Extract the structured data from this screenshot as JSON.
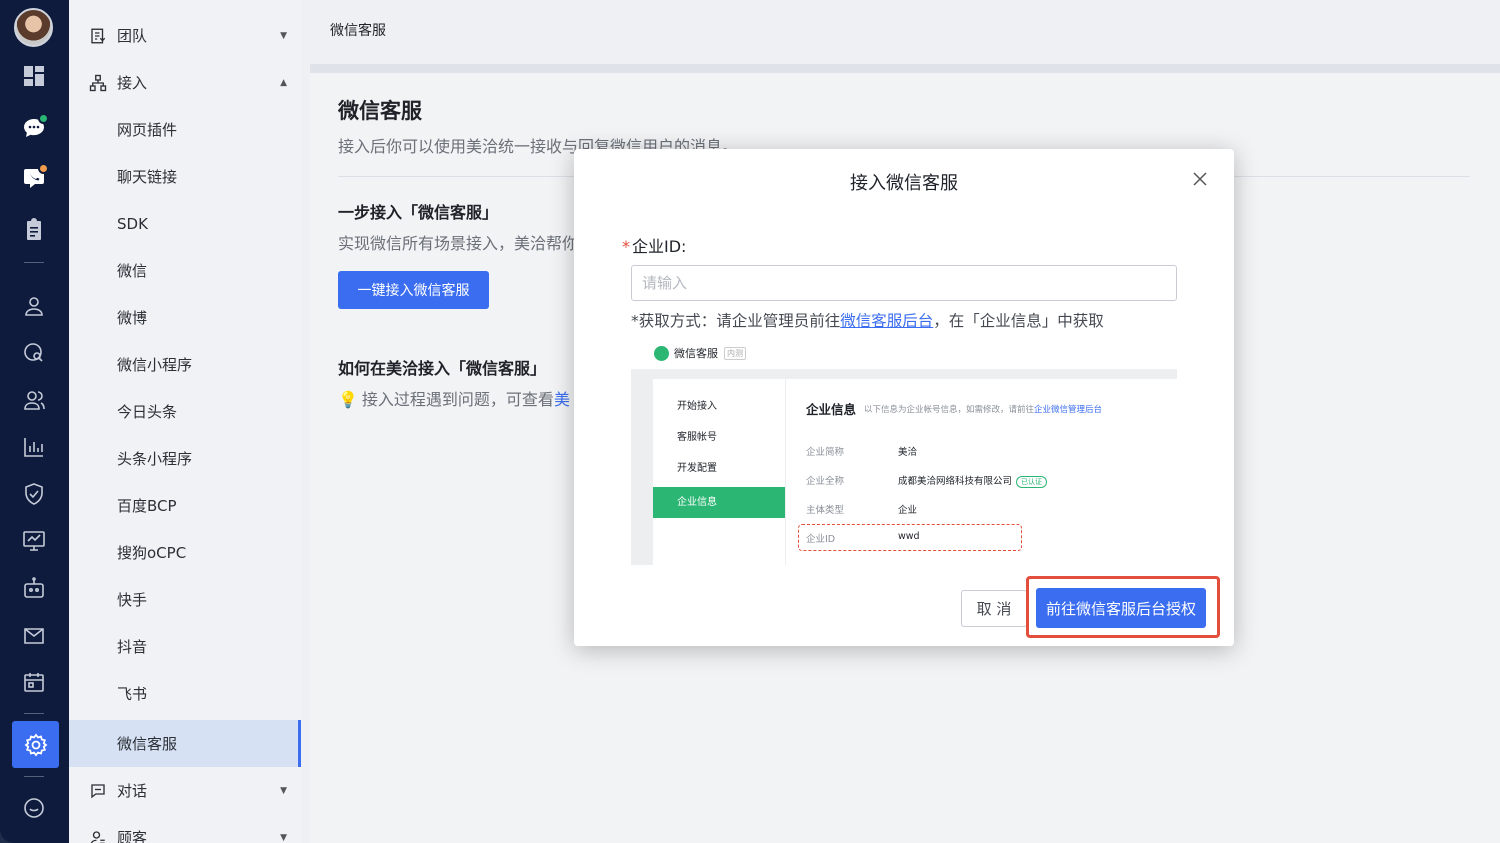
{
  "rail": {
    "icons": [
      "dashboard-icon",
      "chat-icon",
      "phone-chat-icon",
      "clipboard-icon",
      "user-icon",
      "search-user-icon",
      "users-icon",
      "bar-chart-icon",
      "shield-icon",
      "monitor-icon",
      "robot-icon",
      "mail-icon",
      "calendar-icon",
      "gear-icon",
      "message-icon"
    ]
  },
  "menu": {
    "team": "团队",
    "access": "接入",
    "sub_items": [
      "网页插件",
      "聊天链接",
      "SDK",
      "微信",
      "微博",
      "微信小程序",
      "今日头条",
      "头条小程序",
      "百度BCP",
      "搜狗oCPC",
      "快手",
      "抖音",
      "飞书",
      "微信客服"
    ],
    "dialog": "对话",
    "customer": "顾客"
  },
  "topbar": {
    "title": "微信客服"
  },
  "page": {
    "title": "微信客服",
    "description": "接入后你可以使用美洽统一接收与回复微信用户的消息。",
    "section1_title": "一步接入「微信客服」",
    "section1_desc": "实现微信所有场景接入，美洽帮你",
    "section1_button": "一键接入微信客服",
    "section2_title": "如何在美洽接入「微信客服」",
    "section2_desc": "接入过程遇到问题，可查看",
    "section2_link": "美"
  },
  "modal": {
    "title": "接入微信客服",
    "field_label": "企业ID:",
    "required_mark": "*",
    "field_value": "",
    "field_placeholder": "请输入",
    "hint_prefix": "*获取方式：请企业管理员前往",
    "hint_link": "微信客服后台",
    "hint_suffix": "，在「企业信息」中获取",
    "illustration": {
      "app_name": "微信客服",
      "app_tag": "内测",
      "side_items": [
        "开始接入",
        "客服帐号",
        "开发配置",
        "企业信息"
      ],
      "selected_index": 3,
      "info_title": "企业信息",
      "info_sub_prefix": "以下信息为企业帐号信息，如需修改，请前往",
      "info_sub_link": "企业微信管理后台",
      "rows": [
        {
          "label": "企业简称",
          "value": "美洽"
        },
        {
          "label": "企业全称",
          "value": "成都美洽网络科技有限公司",
          "badge": "已认证"
        },
        {
          "label": "主体类型",
          "value": "企业"
        },
        {
          "label": "企业ID",
          "value": "wwd"
        }
      ]
    },
    "cancel_label": "取 消",
    "confirm_label": "前往微信客服后台授权"
  },
  "colors": {
    "primary": "#3a6df0",
    "rail_bg": "#0e1b3d",
    "wechat_green": "#2bb673",
    "highlight_red": "#e34d3b"
  }
}
